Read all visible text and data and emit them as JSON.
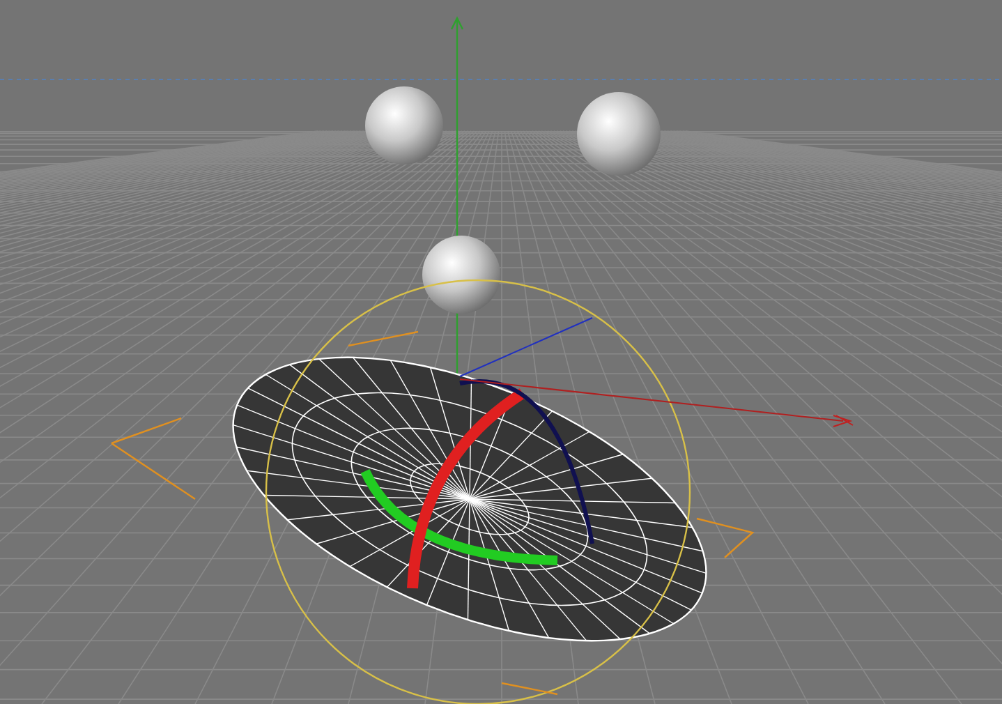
{
  "viewport": {
    "objects": [
      {
        "kind": "sphere"
      },
      {
        "kind": "sphere"
      },
      {
        "kind": "sphere"
      },
      {
        "kind": "disc"
      }
    ]
  }
}
